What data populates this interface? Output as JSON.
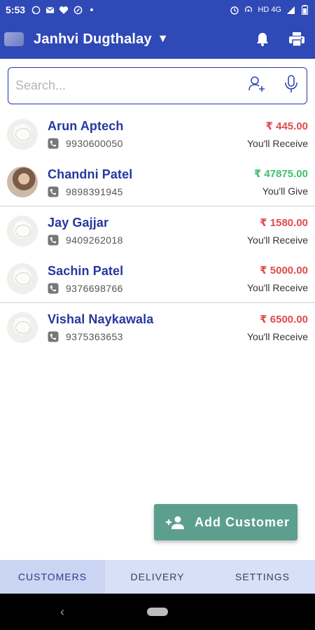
{
  "status_bar": {
    "time": "5:53",
    "network": "HD 4G"
  },
  "app_bar": {
    "business_name": "Janhvi Dugthalay",
    "dropdown_glyph": "▼"
  },
  "search": {
    "placeholder": "Search..."
  },
  "customers": [
    {
      "name": "Arun Aptech",
      "phone": "9930600050",
      "amount": "₹ 445.00",
      "direction": "You'll Receive",
      "type": "receive"
    },
    {
      "name": "Chandni Patel",
      "phone": "9898391945",
      "amount": "₹ 47875.00",
      "direction": "You'll Give",
      "type": "give"
    },
    {
      "name": "Jay Gajjar",
      "phone": "9409262018",
      "amount": "₹ 1580.00",
      "direction": "You'll Receive",
      "type": "receive"
    },
    {
      "name": "Sachin Patel",
      "phone": "9376698766",
      "amount": "₹ 5000.00",
      "direction": "You'll Receive",
      "type": "receive"
    },
    {
      "name": "Vishal Naykawala",
      "phone": "9375363653",
      "amount": "₹ 6500.00",
      "direction": "You'll Receive",
      "type": "receive"
    }
  ],
  "fab": {
    "label": "Add Customer"
  },
  "tabs": [
    "CUSTOMERS",
    "DELIVERY",
    "SETTINGS"
  ],
  "colors": {
    "primary": "#2f49b7",
    "receive": "#e04b4b",
    "give": "#3ec06a",
    "fab": "#5d9f8e"
  }
}
